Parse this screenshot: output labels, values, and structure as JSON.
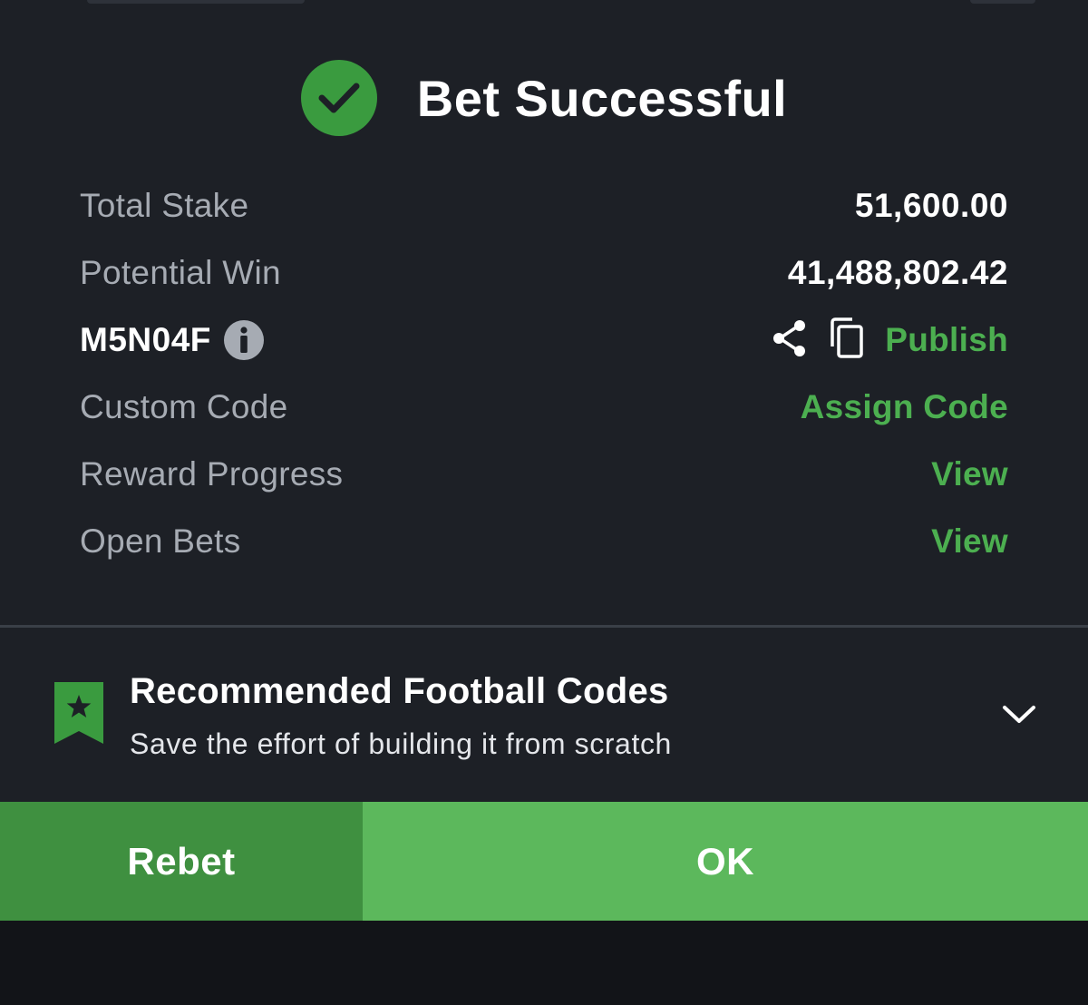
{
  "header": {
    "title": "Bet Successful",
    "icon": "check-circle-icon"
  },
  "summary": {
    "total_stake": {
      "label": "Total Stake",
      "value": "51,600.00"
    },
    "potential_win": {
      "label": "Potential Win",
      "value": "41,488,802.42"
    },
    "booking": {
      "code": "M5N04F",
      "info_icon": "info-icon",
      "share_icon": "share-icon",
      "copy_icon": "copy-icon",
      "publish_label": "Publish"
    },
    "custom_code": {
      "label": "Custom Code",
      "action": "Assign Code"
    },
    "reward_progress": {
      "label": "Reward Progress",
      "action": "View"
    },
    "open_bets": {
      "label": "Open Bets",
      "action": "View"
    }
  },
  "recommended": {
    "icon": "bookmark-star-icon",
    "title": "Recommended Football Codes",
    "subtitle": "Save the effort of building it from scratch",
    "expand_icon": "chevron-down-icon"
  },
  "buttons": {
    "rebet": "Rebet",
    "ok": "OK"
  },
  "colors": {
    "accent": "#4caf50",
    "ok_button": "#5cb85c",
    "rebet_button": "#3f9040",
    "background": "#1d2026"
  }
}
